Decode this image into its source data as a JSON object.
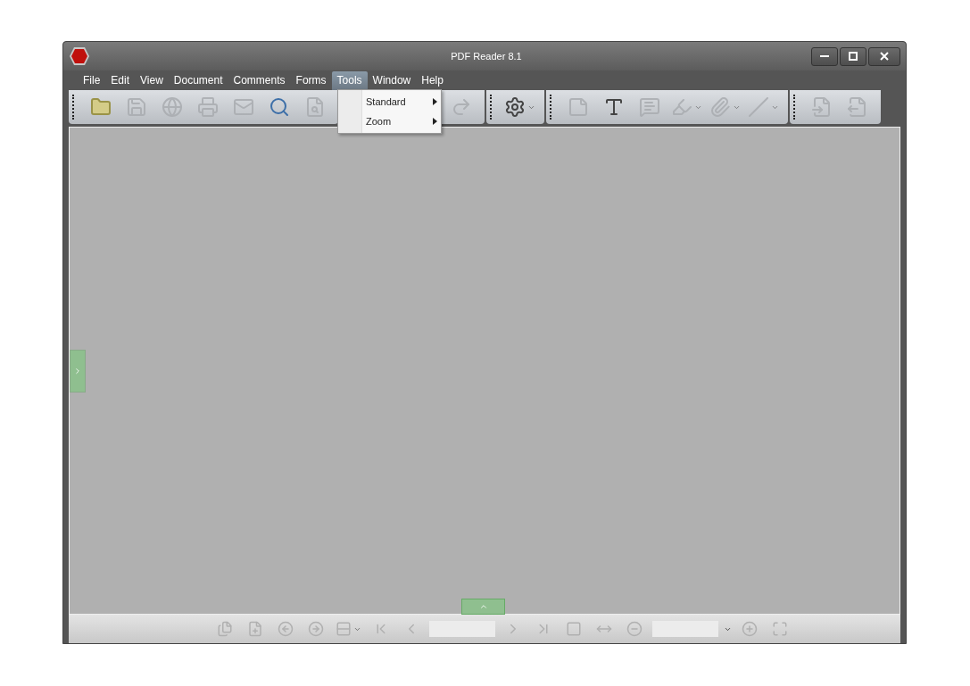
{
  "window": {
    "title": "PDF Reader 8.1"
  },
  "menu": [
    {
      "label": "File",
      "selected": false
    },
    {
      "label": "Edit",
      "selected": false
    },
    {
      "label": "View",
      "selected": false
    },
    {
      "label": "Document",
      "selected": false
    },
    {
      "label": "Comments",
      "selected": false
    },
    {
      "label": "Forms",
      "selected": false
    },
    {
      "label": "Tools",
      "selected": true
    },
    {
      "label": "Window",
      "selected": false
    },
    {
      "label": "Help",
      "selected": false
    }
  ],
  "open_menu": {
    "items": [
      {
        "label": "Standard"
      },
      {
        "label": "Zoom"
      }
    ]
  },
  "toolbar": {
    "groups": [
      {
        "tools": [
          {
            "kind": "folder",
            "disabled": false
          },
          {
            "kind": "save",
            "disabled": true
          },
          {
            "kind": "globe",
            "disabled": true
          },
          {
            "kind": "print",
            "disabled": true
          },
          {
            "kind": "mail",
            "disabled": true
          },
          {
            "kind": "search",
            "disabled": false
          },
          {
            "kind": "find-doc",
            "disabled": true
          }
        ]
      },
      {
        "tools": [
          {
            "kind": "redo",
            "disabled": true
          }
        ]
      },
      {
        "tools": [
          {
            "kind": "settings",
            "disabled": false,
            "dropdown": true
          }
        ]
      },
      {
        "tools": [
          {
            "kind": "note",
            "disabled": true
          },
          {
            "kind": "text",
            "disabled": false
          },
          {
            "kind": "comment",
            "disabled": true
          },
          {
            "kind": "highlight",
            "disabled": true,
            "dropdown": true
          },
          {
            "kind": "attach",
            "disabled": true,
            "dropdown": true
          },
          {
            "kind": "line",
            "disabled": true,
            "dropdown": true
          }
        ]
      },
      {
        "tools": [
          {
            "kind": "doc-back",
            "disabled": true
          },
          {
            "kind": "doc-forward",
            "disabled": true
          }
        ]
      }
    ]
  },
  "side_panel": {
    "expanded": false
  },
  "bottom_panel": {
    "expanded": false
  },
  "bottom_bar": [
    {
      "kind": "extract"
    },
    {
      "kind": "insert"
    },
    {
      "kind": "back"
    },
    {
      "kind": "forward"
    },
    {
      "kind": "layout",
      "dropdown": true
    },
    {
      "kind": "first"
    },
    {
      "kind": "prev"
    },
    {
      "kind": "field"
    },
    {
      "kind": "next"
    },
    {
      "kind": "last"
    },
    {
      "kind": "page"
    },
    {
      "kind": "fit-width"
    },
    {
      "kind": "zoom-out"
    },
    {
      "kind": "field",
      "dropdown": true
    },
    {
      "kind": "zoom-in"
    },
    {
      "kind": "fullscreen"
    }
  ]
}
